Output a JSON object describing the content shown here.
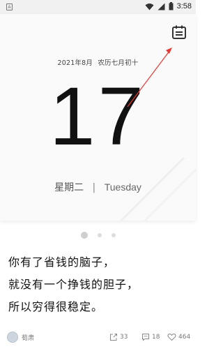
{
  "status_bar": {
    "app_icon_letter": "A",
    "time": "3:58"
  },
  "card": {
    "date_line": {
      "solar": "2021年8月",
      "lunar": "农历七月初十"
    },
    "day_number": "17",
    "weekday_cn": "星期二",
    "separator": "|",
    "weekday_en": "Tuesday"
  },
  "pager": {
    "count": 3,
    "active_index": 0
  },
  "quote": {
    "lines": [
      "你有了省钱的脑子，",
      "就没有一个挣钱的胆子，",
      "所以穷得很稳定。"
    ]
  },
  "footer": {
    "author_name": "荀肃",
    "share_count": "33",
    "comment_count": "18",
    "like_count": "464"
  },
  "annotation": {
    "arrow_color": "#e53935"
  },
  "icons": {
    "calendar": "calendar-icon",
    "wifi": "wifi-icon",
    "signal": "signal-icon",
    "battery": "battery-icon",
    "share": "share-icon",
    "comment": "comment-icon",
    "like": "heart-icon"
  }
}
